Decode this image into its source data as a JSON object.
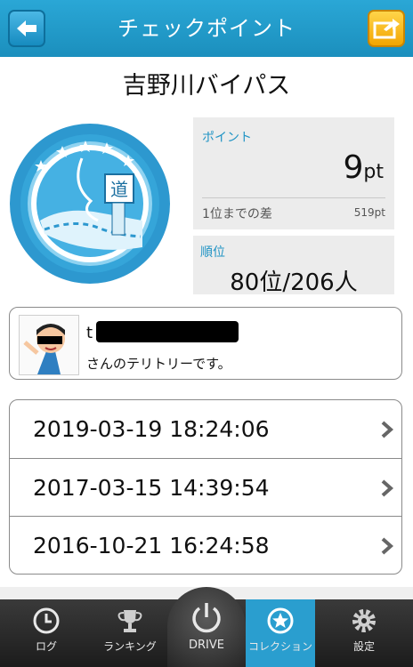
{
  "header": {
    "title": "チェックポイント"
  },
  "route": {
    "name": "吉野川バイパス"
  },
  "badge": {
    "sign_text": "道"
  },
  "points": {
    "label": "ポイント",
    "value": "9",
    "unit": "pt",
    "diff_label": "1位までの差",
    "diff_value": "519pt"
  },
  "rank": {
    "label": "順位",
    "value": "80位/206人"
  },
  "territory": {
    "owner_name_visible": "t",
    "message": "さんのテリトリーです。"
  },
  "history": [
    {
      "datetime": "2019-03-19 18:24:06"
    },
    {
      "datetime": "2017-03-15 14:39:54"
    },
    {
      "datetime": "2016-10-21 16:24:58"
    }
  ],
  "tabs": [
    {
      "label": "ログ",
      "icon": "clock-icon"
    },
    {
      "label": "ランキング",
      "icon": "trophy-icon"
    },
    {
      "label": "DRIVE",
      "icon": "power-icon"
    },
    {
      "label": "コレクション",
      "icon": "star-icon",
      "active": true
    },
    {
      "label": "設定",
      "icon": "gear-icon"
    }
  ],
  "colors": {
    "header": "#1b8fbd",
    "accent": "#1f93c4",
    "active_tab": "#2a9ecf"
  }
}
